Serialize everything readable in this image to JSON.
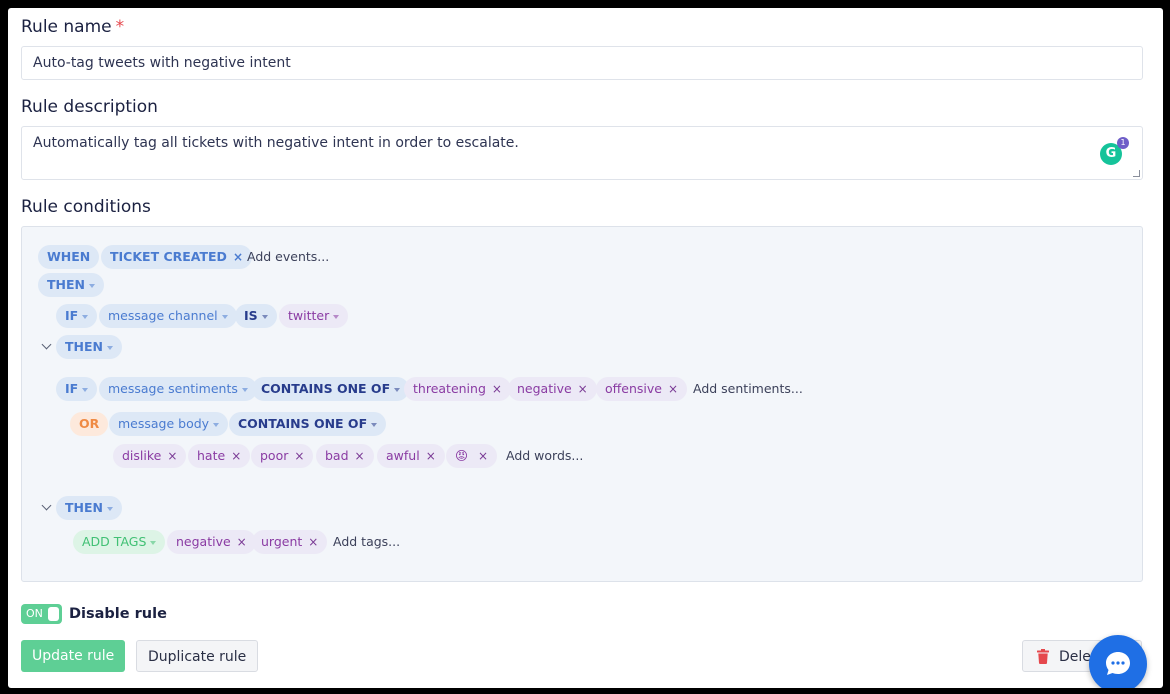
{
  "rule_name": {
    "label": "Rule name",
    "required_mark": "*",
    "value": "Auto-tag tweets with negative intent"
  },
  "rule_description": {
    "label": "Rule description",
    "value": "Automatically tag all tickets with negative intent in order to escalate.",
    "grammarly_badge": "1"
  },
  "rule_conditions": {
    "label": "Rule conditions",
    "when": {
      "keyword": "WHEN",
      "event": "TICKET CREATED",
      "add_placeholder": "Add events..."
    },
    "then_1": "THEN",
    "if_1": {
      "keyword": "IF",
      "field": "message channel",
      "operator": "IS",
      "value": "twitter"
    },
    "then_2": "THEN",
    "if_2": {
      "keyword": "IF",
      "field": "message sentiments",
      "operator": "CONTAINS ONE OF",
      "values": [
        "threatening",
        "negative",
        "offensive"
      ],
      "add_placeholder": "Add sentiments..."
    },
    "or": {
      "keyword": "OR",
      "field": "message body",
      "operator": "CONTAINS ONE OF",
      "values": [
        "dislike",
        "hate",
        "poor",
        "bad",
        "awful",
        "😡"
      ],
      "add_placeholder": "Add words..."
    },
    "then_3": "THEN",
    "action": {
      "keyword": "ADD TAGS",
      "tags": [
        "negative",
        "urgent"
      ],
      "add_placeholder": "Add tags..."
    }
  },
  "toggle": {
    "state": "ON",
    "label": "Disable rule"
  },
  "buttons": {
    "update": "Update rule",
    "duplicate": "Duplicate rule",
    "delete": "Dele"
  },
  "colors": {
    "accent_green": "#5ecf95",
    "delete_red": "#e5484d",
    "chat_blue": "#1f6fe5"
  }
}
